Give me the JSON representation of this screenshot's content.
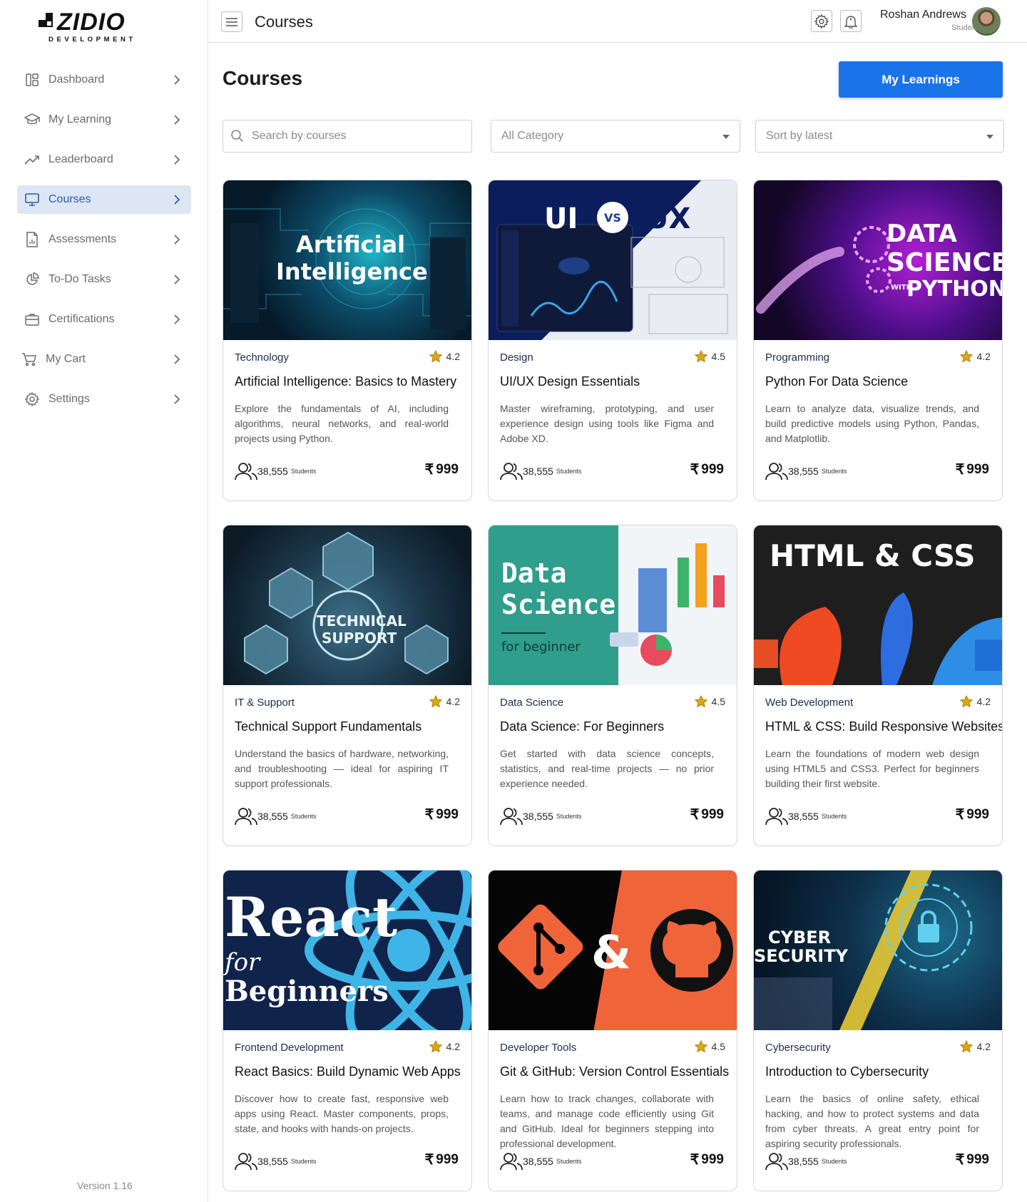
{
  "brand": {
    "name": "ZIDIO",
    "sub": "DEVELOPMENT"
  },
  "sidebar": {
    "items": [
      {
        "label": "Dashboard",
        "icon": "dashboard-icon"
      },
      {
        "label": "My Learning",
        "icon": "graduation-cap-icon"
      },
      {
        "label": "Leaderboard",
        "icon": "trending-up-icon"
      },
      {
        "label": "Courses",
        "icon": "monitor-icon",
        "active": true
      },
      {
        "label": "Assessments",
        "icon": "document-chart-icon"
      },
      {
        "label": "To-Do Tasks",
        "icon": "pie-chart-icon"
      },
      {
        "label": "Certifications",
        "icon": "briefcase-icon"
      },
      {
        "label": "My Cart",
        "icon": "cart-icon"
      },
      {
        "label": "Settings",
        "icon": "gear-icon"
      }
    ],
    "version": "Version 1.16"
  },
  "header": {
    "title": "Courses",
    "user_name": "Roshan Andrews",
    "user_role": "Student"
  },
  "main": {
    "title": "Courses",
    "my_learnings_label": "My Learnings",
    "search_placeholder": "Search by courses",
    "category_value": "All Category",
    "sort_value": "Sort by latest"
  },
  "courses": [
    {
      "category": "Technology",
      "rating": "4.2",
      "title": "Artificial Intelligence:  Basics to Mastery",
      "description": "Explore the fundamentals of AI, including algorithms, neural networks, and real-world projects using Python.",
      "students": "38,555",
      "students_label": "Students",
      "price": "999",
      "thumb_l1": "Artificial",
      "thumb_l2": "Intelligence"
    },
    {
      "category": "Design",
      "rating": "4.5",
      "title": "UI/UX Design Essentials",
      "description": "Master wireframing, prototyping, and user experience design using tools like Figma and Adobe XD.",
      "students": "38,555",
      "students_label": "Students",
      "price": "999",
      "thumb_l1": "UI",
      "thumb_vs": "VS",
      "thumb_l2": "UX"
    },
    {
      "category": "Programming",
      "rating": "4.2",
      "title": "Python For Data Science",
      "description": "Learn to analyze data, visualize trends, and build predictive models using Python, Pandas, and Matplotlib.",
      "students": "38,555",
      "students_label": "Students",
      "price": "999",
      "thumb_l1": "DATA",
      "thumb_l2": "SCIENCE",
      "thumb_with": "WITH",
      "thumb_l3": "PYTHON"
    },
    {
      "category": "IT & Support",
      "rating": "4.2",
      "title": "Technical Support Fundamentals",
      "description": "Understand the basics of hardware, networking, and troubleshooting — ideal for aspiring IT support professionals.",
      "students": "38,555",
      "students_label": "Students",
      "price": "999",
      "thumb_l1": "TECHNICAL",
      "thumb_l2": "SUPPORT"
    },
    {
      "category": "Data Science",
      "rating": "4.5",
      "title": "Data Science: For Beginners",
      "description": "Get started with data science concepts, statistics, and real-time projects — no prior experience needed.",
      "students": "38,555",
      "students_label": "Students",
      "price": "999",
      "thumb_l1": "Data",
      "thumb_l2": "Science",
      "thumb_l3": "for beginner"
    },
    {
      "category": "Web Development",
      "rating": "4.2",
      "title": "HTML & CSS: Build Responsive Websites",
      "description": "Learn the foundations of modern web design using HTML5 and CSS3. Perfect for beginners building their first website.",
      "students": "38,555",
      "students_label": "Students",
      "price": "999",
      "thumb_l1": "HTML & CSS"
    },
    {
      "category": "Frontend Development",
      "rating": "4.2",
      "title": "React Basics: Build Dynamic Web Apps",
      "description": "Discover how to create fast, responsive web apps using React. Master components, props, state, and hooks with hands-on projects.",
      "students": "38,555",
      "students_label": "Students",
      "price": "999",
      "thumb_l1": "React",
      "thumb_l2": "for",
      "thumb_l3": "Beginners"
    },
    {
      "category": "Developer Tools",
      "rating": "4.5",
      "title": "Git & GitHub: Version Control Essentials",
      "description": "Learn how to track changes, collaborate with teams, and manage code efficiently using Git and GitHub. Ideal for beginners stepping into professional development.",
      "students": "38,555",
      "students_label": "Students",
      "price": "999",
      "thumb_l1": "&"
    },
    {
      "category": "Cybersecurity",
      "rating": "4.2",
      "title": "Introduction to Cybersecurity",
      "description": "Learn the basics of online safety, ethical hacking, and how to protect systems and data from cyber threats. A great entry point for aspiring security professionals.",
      "students": "38,555",
      "students_label": "Students",
      "price": "999",
      "thumb_l1": "CYBER",
      "thumb_l2": "SECURITY"
    }
  ]
}
